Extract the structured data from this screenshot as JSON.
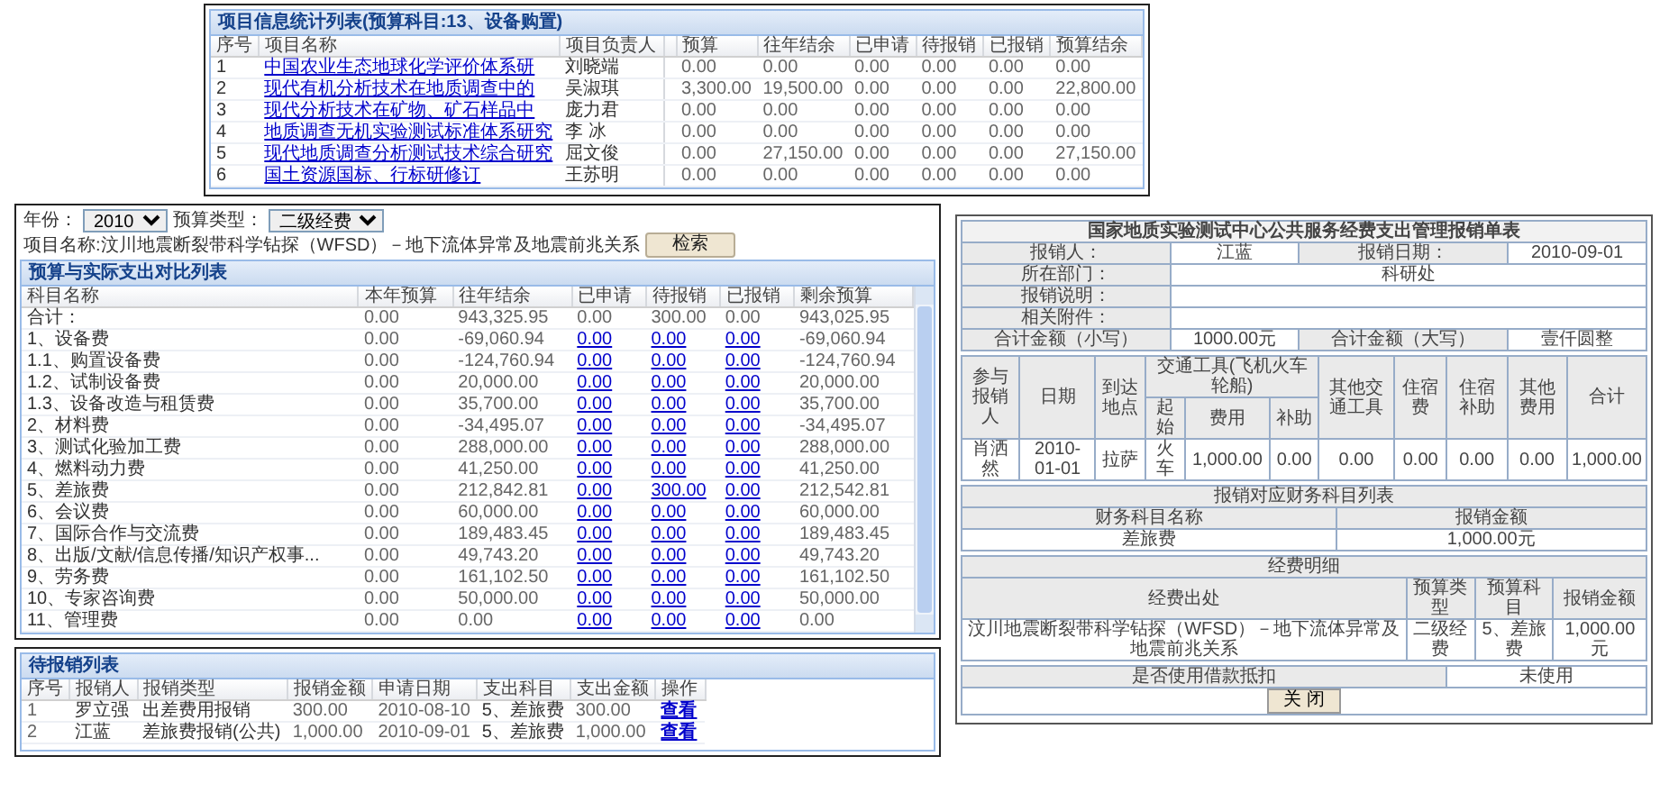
{
  "project_panel": {
    "title": "项目信息统计列表(预算科目:13、设备购置)",
    "columns": [
      "序号",
      "项目名称",
      "项目负责人",
      "预算",
      "往年结余",
      "已申请",
      "待报销",
      "已报销",
      "预算结余"
    ],
    "rows": [
      {
        "index": "1",
        "name": "中国农业生态地球化学评价体系研",
        "leader": "刘晓端",
        "values": [
          "0.00",
          "0.00",
          "0.00",
          "0.00",
          "0.00",
          "0.00"
        ]
      },
      {
        "index": "2",
        "name": "现代有机分析技术在地质调查中的",
        "leader": "吴淑琪",
        "values": [
          "3,300.00",
          "19,500.00",
          "0.00",
          "0.00",
          "0.00",
          "22,800.00"
        ]
      },
      {
        "index": "3",
        "name": "现代分析技术在矿物、矿石样品中",
        "leader": "庞力君",
        "values": [
          "0.00",
          "0.00",
          "0.00",
          "0.00",
          "0.00",
          "0.00"
        ]
      },
      {
        "index": "4",
        "name": "地质调查无机实验测试标准体系研究",
        "leader": "李 冰",
        "values": [
          "0.00",
          "0.00",
          "0.00",
          "0.00",
          "0.00",
          "0.00"
        ]
      },
      {
        "index": "5",
        "name": "现代地质调查分析测试技术综合研究",
        "leader": "屈文俊",
        "values": [
          "0.00",
          "27,150.00",
          "0.00",
          "0.00",
          "0.00",
          "27,150.00"
        ]
      },
      {
        "index": "6",
        "name": "国土资源国标、行标研修订",
        "leader": "王苏明",
        "values": [
          "0.00",
          "0.00",
          "0.00",
          "0.00",
          "0.00",
          "0.00"
        ]
      }
    ]
  },
  "filter_bar": {
    "year_label": "年份：",
    "year": "2010",
    "type_label": "预算类型：",
    "type": "二级经费",
    "project": "项目名称:汶川地震断裂带科学钻探（WFSD）－地下流体异常及地震前兆关系",
    "search_button": "检索"
  },
  "budget_panel": {
    "title": "预算与实际支出对比列表",
    "columns": [
      "科目名称",
      "本年预算",
      "往年结余",
      "已申请",
      "待报销",
      "已报销",
      "剩余预算"
    ],
    "rows": [
      {
        "kind": "total",
        "subject": "合计：",
        "values": [
          "0.00",
          "943,325.95",
          "0.00",
          "300.00",
          "0.00",
          "943,025.95"
        ]
      },
      {
        "kind": "item",
        "subject": "1、设备费",
        "values": [
          "0.00",
          "-69,060.94",
          "0.00",
          "0.00",
          "0.00",
          "-69,060.94"
        ]
      },
      {
        "kind": "item",
        "subject": "1.1、购置设备费",
        "values": [
          "0.00",
          "-124,760.94",
          "0.00",
          "0.00",
          "0.00",
          "-124,760.94"
        ]
      },
      {
        "kind": "item",
        "subject": "1.2、试制设备费",
        "values": [
          "0.00",
          "20,000.00",
          "0.00",
          "0.00",
          "0.00",
          "20,000.00"
        ]
      },
      {
        "kind": "item",
        "subject": "1.3、设备改造与租赁费",
        "values": [
          "0.00",
          "35,700.00",
          "0.00",
          "0.00",
          "0.00",
          "35,700.00"
        ]
      },
      {
        "kind": "item",
        "subject": "2、材料费",
        "values": [
          "0.00",
          "-34,495.07",
          "0.00",
          "0.00",
          "0.00",
          "-34,495.07"
        ]
      },
      {
        "kind": "item",
        "subject": "3、测试化验加工费",
        "values": [
          "0.00",
          "288,000.00",
          "0.00",
          "0.00",
          "0.00",
          "288,000.00"
        ]
      },
      {
        "kind": "item",
        "subject": "4、燃料动力费",
        "values": [
          "0.00",
          "41,250.00",
          "0.00",
          "0.00",
          "0.00",
          "41,250.00"
        ]
      },
      {
        "kind": "item",
        "subject": "5、差旅费",
        "values": [
          "0.00",
          "212,842.81",
          "0.00",
          "300.00",
          "0.00",
          "212,542.81"
        ]
      },
      {
        "kind": "item",
        "subject": "6、会议费",
        "values": [
          "0.00",
          "60,000.00",
          "0.00",
          "0.00",
          "0.00",
          "60,000.00"
        ]
      },
      {
        "kind": "item",
        "subject": "7、国际合作与交流费",
        "values": [
          "0.00",
          "189,483.45",
          "0.00",
          "0.00",
          "0.00",
          "189,483.45"
        ]
      },
      {
        "kind": "item",
        "subject": "8、出版/文献/信息传播/知识产权事...",
        "values": [
          "0.00",
          "49,743.20",
          "0.00",
          "0.00",
          "0.00",
          "49,743.20"
        ]
      },
      {
        "kind": "item",
        "subject": "9、劳务费",
        "values": [
          "0.00",
          "161,102.50",
          "0.00",
          "0.00",
          "0.00",
          "161,102.50"
        ]
      },
      {
        "kind": "item",
        "subject": "10、专家咨询费",
        "values": [
          "0.00",
          "50,000.00",
          "0.00",
          "0.00",
          "0.00",
          "50,000.00"
        ]
      },
      {
        "kind": "item",
        "subject": "11、管理费",
        "values": [
          "0.00",
          "0.00",
          "0.00",
          "0.00",
          "0.00",
          "0.00"
        ]
      }
    ]
  },
  "pending_panel": {
    "title": "待报销列表",
    "columns": [
      "序号",
      "报销人",
      "报销类型",
      "报销金额",
      "申请日期",
      "支出科目",
      "支出金额",
      "操作"
    ],
    "rows": [
      {
        "cells": [
          "1",
          "罗立强",
          "出差费用报销",
          "300.00",
          "2010-08-10",
          "5、差旅费",
          "300.00"
        ],
        "action": "查看"
      },
      {
        "cells": [
          "2",
          "江蓝",
          "差旅费报销(公共)",
          "1,000.00",
          "2010-09-01",
          "5、差旅费",
          "1,000.00"
        ],
        "action": "查看"
      }
    ]
  },
  "reimbursement_form": {
    "title": "国家地质实验测试中心公共服务经费支出管理报销单表",
    "info_rows": [
      [
        {
          "label": "报销人：",
          "value": "江蓝"
        },
        {
          "label": "报销日期：",
          "value": "2010-09-01"
        }
      ],
      [
        {
          "label": "所在部门：",
          "value": "科研处"
        }
      ],
      [
        {
          "label": "报销说明："
        }
      ],
      [
        {
          "label": "相关附件："
        }
      ],
      [
        {
          "label": "合计金额（小写）",
          "value": "1000.00元"
        },
        {
          "label": "合计金额（大写）",
          "value": "壹仟圆整"
        }
      ]
    ],
    "travel_table": {
      "columns_before": [
        "参与报销人",
        "日期",
        "到达地点"
      ],
      "transport": {
        "label": "交通工具(飞机火车轮船)",
        "columns": [
          "起始",
          "费用",
          "补助"
        ]
      },
      "columns_after": [
        "其他交通工具",
        "住宿费",
        "住宿补助",
        "其他费用",
        "合计"
      ],
      "rows": [
        [
          "肖洒然",
          "2010-01-01",
          "拉萨",
          "火车",
          "1,000.00",
          "0.00",
          "0.00",
          "0.00",
          "0.00",
          "0.00",
          "1,000.00"
        ]
      ]
    },
    "subject_section": {
      "title": "报销对应财务科目列表",
      "columns": [
        "财务科目名称",
        "报销金额"
      ],
      "rows": [
        [
          "差旅费",
          "1,000.00元"
        ]
      ]
    },
    "fund_section": {
      "title": "经费明细",
      "columns": [
        "经费出处",
        "预算类型",
        "预算科目",
        "报销金额"
      ],
      "rows": [
        [
          "汶川地震断裂带科学钻探（WFSD）－地下流体异常及地震前兆关系",
          "二级经费",
          "5、差旅费",
          "1,000.00元"
        ]
      ]
    },
    "loan_row": {
      "label": "是否使用借款抵扣",
      "value": "未使用"
    },
    "close_button": "关 闭"
  }
}
